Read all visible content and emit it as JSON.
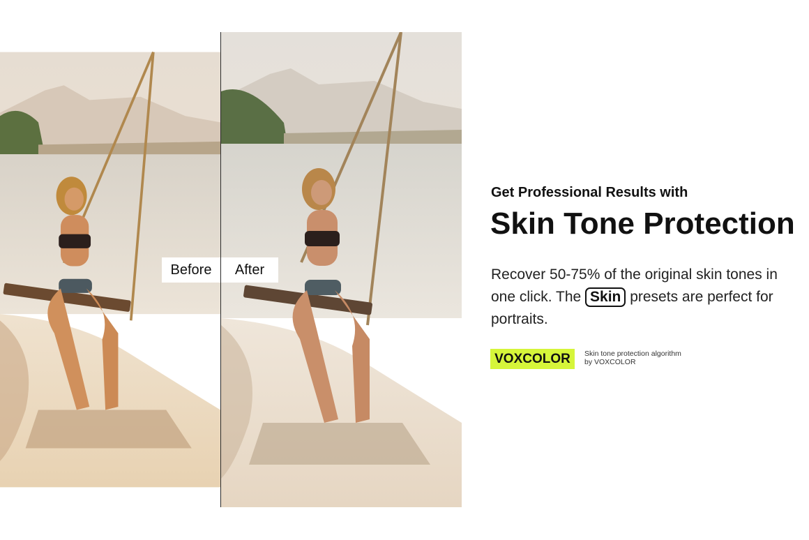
{
  "comparison": {
    "before_label": "Before",
    "after_label": "After"
  },
  "promo": {
    "subtitle": "Get Professional Results with",
    "title": "Skin Tone Protection",
    "description_before": "Recover 50-75% of the original skin tones in one click.  The ",
    "skin_chip": "Skin",
    "description_after": " presets are perfect for portraits.",
    "brand_badge": "VOXCOLOR",
    "brand_note": "Skin tone protection algorithm by VOXCOLOR"
  },
  "colors": {
    "badge": "#d6f53a",
    "text": "#111111"
  }
}
